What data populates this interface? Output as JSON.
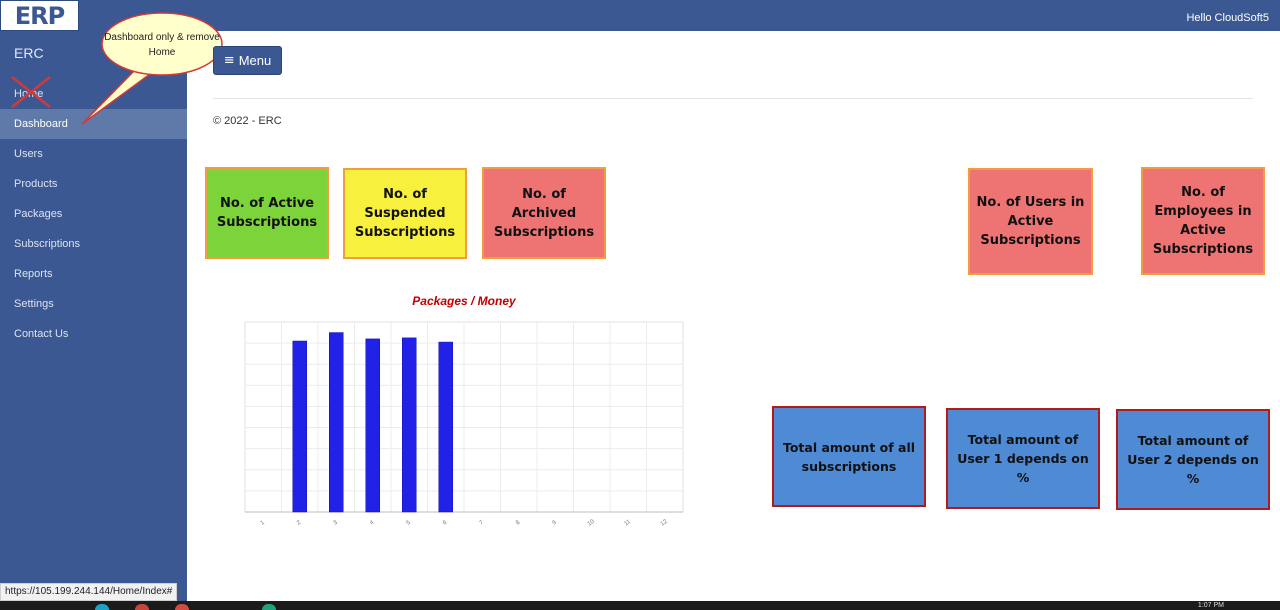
{
  "header": {
    "logo_text": "ERP",
    "greeting": "Hello CloudSoft5"
  },
  "sidebar": {
    "brand": "ERC",
    "items": [
      {
        "label": "Home",
        "crossed_out": true
      },
      {
        "label": "Dashboard",
        "active": true
      },
      {
        "label": "Users"
      },
      {
        "label": "Products"
      },
      {
        "label": "Packages"
      },
      {
        "label": "Subscriptions"
      },
      {
        "label": "Reports"
      },
      {
        "label": "Settings"
      },
      {
        "label": "Contact Us"
      }
    ]
  },
  "annotation": {
    "callout_text": "Dashboard only & remove Home"
  },
  "main": {
    "menu_label": "Menu",
    "menu_icon": "hamburger-icon",
    "copyright": "© 2022 - ERC"
  },
  "cards": {
    "active_subscriptions": "No. of Active Subscriptions",
    "suspended_subscriptions": "No. of Suspended Subscriptions",
    "archived_subscriptions": "No. of Archived Subscriptions",
    "users_in_active": "No. of Users in Active Subscriptions",
    "employees_in_active": "No. of Employees in Active Subscriptions",
    "total_amount_all": "Total amount of all subscriptions",
    "total_user1": "Total amount of User 1 depends on %",
    "total_user2": "Total amount of User 2 depends on %"
  },
  "card_colors": {
    "green": "#7cd33a",
    "yellow": "#f7f03c",
    "salmon": "#ee7373",
    "blue": "#4f8ad4",
    "orange_border": "#f39c3f",
    "red_border": "#b31b1b"
  },
  "chart_data": {
    "type": "bar",
    "title": "Packages / Money",
    "categories": [
      "1",
      "2",
      "3",
      "4",
      "5",
      "6",
      "7",
      "8",
      "9",
      "10",
      "11",
      "12"
    ],
    "values": [
      0,
      8.1,
      8.5,
      8.2,
      8.25,
      8.05,
      0,
      0,
      0,
      0,
      0,
      0
    ],
    "ylim": [
      0,
      9
    ],
    "grid": true,
    "bar_color": "#2121e8"
  },
  "statusbar": {
    "url": "https://105.199.244.144/Home/Index#"
  },
  "taskbar": {
    "clock": "1:07 PM"
  }
}
